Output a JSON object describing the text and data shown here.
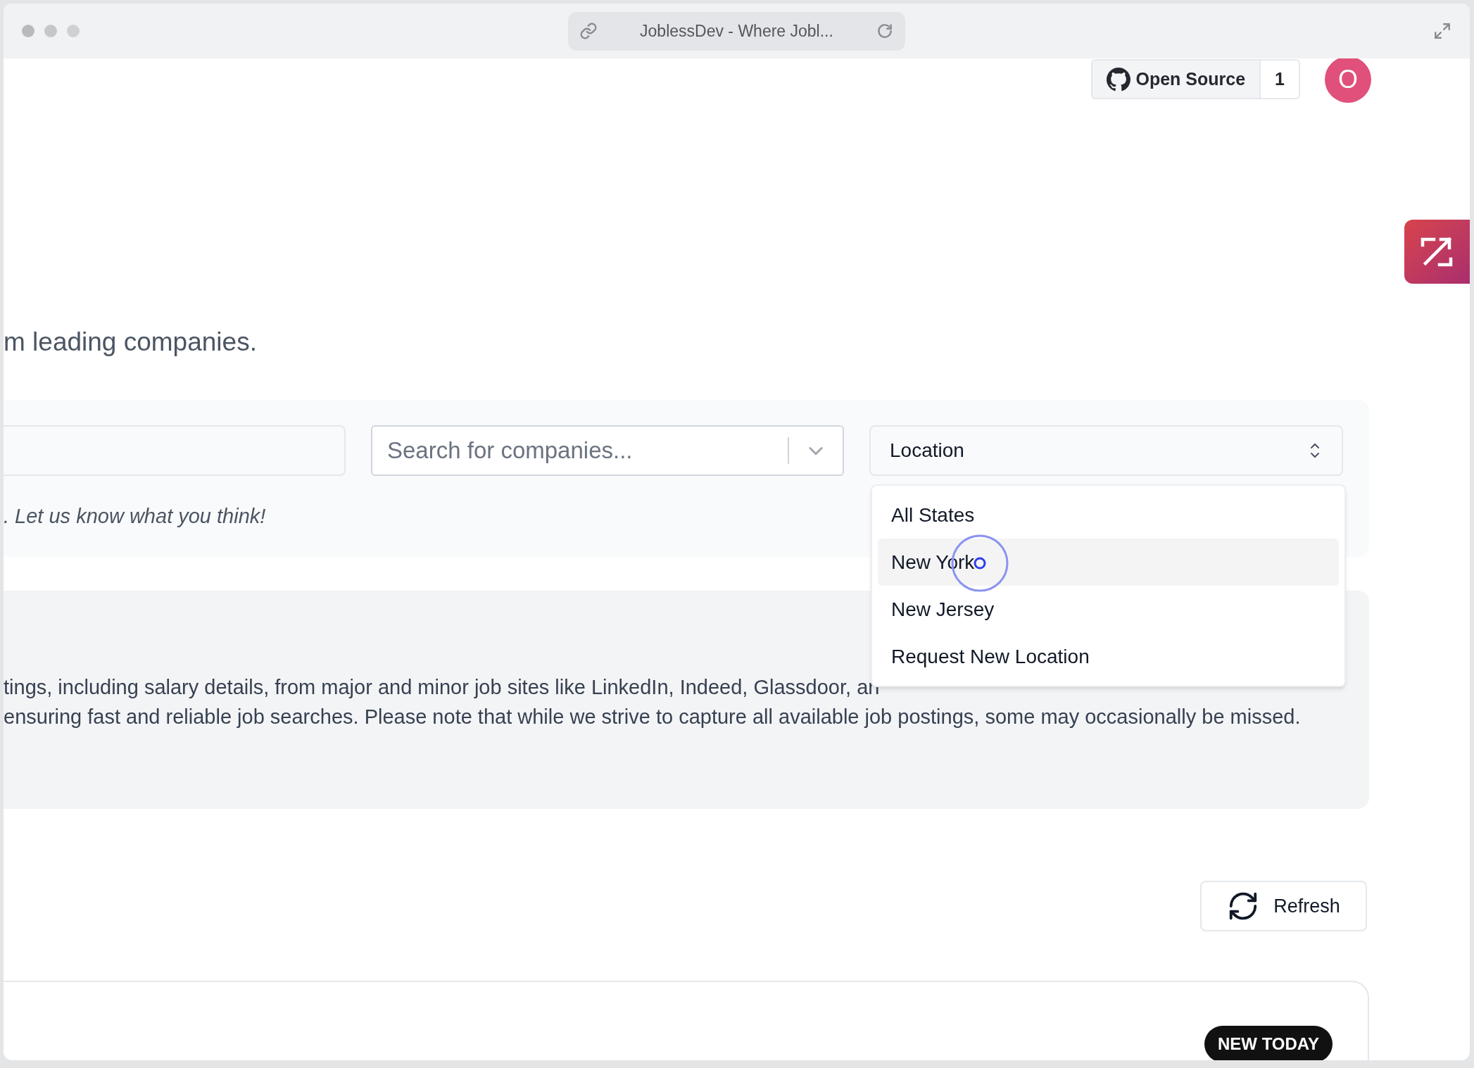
{
  "browser": {
    "title": "JoblessDev - Where Jobl..."
  },
  "header": {
    "open_source": "Open Source",
    "star_count": "1",
    "avatar": "O"
  },
  "hero": {
    "subtitle": "m leading companies."
  },
  "filters": {
    "company_search": {
      "placeholder": "Search for companies..."
    },
    "location": {
      "value": "Location",
      "expanded": true,
      "options": [
        {
          "label": "All States",
          "selected": false
        },
        {
          "label": "New York",
          "selected": true
        },
        {
          "label": "New Jersey",
          "selected": false
        },
        {
          "label": "Request New Location",
          "selected": false
        }
      ]
    },
    "note": ". Let us know what you think!"
  },
  "info": {
    "lines": [
      "tings, including salary details, from major and minor job sites like LinkedIn, Indeed, Glassdoor, an",
      "ensuring fast and reliable job searches. Please note that while we strive to capture all available job postings, some may occasionally be missed."
    ]
  },
  "refresh": "Refresh",
  "listing": {
    "badge": "NEW TODAY"
  }
}
